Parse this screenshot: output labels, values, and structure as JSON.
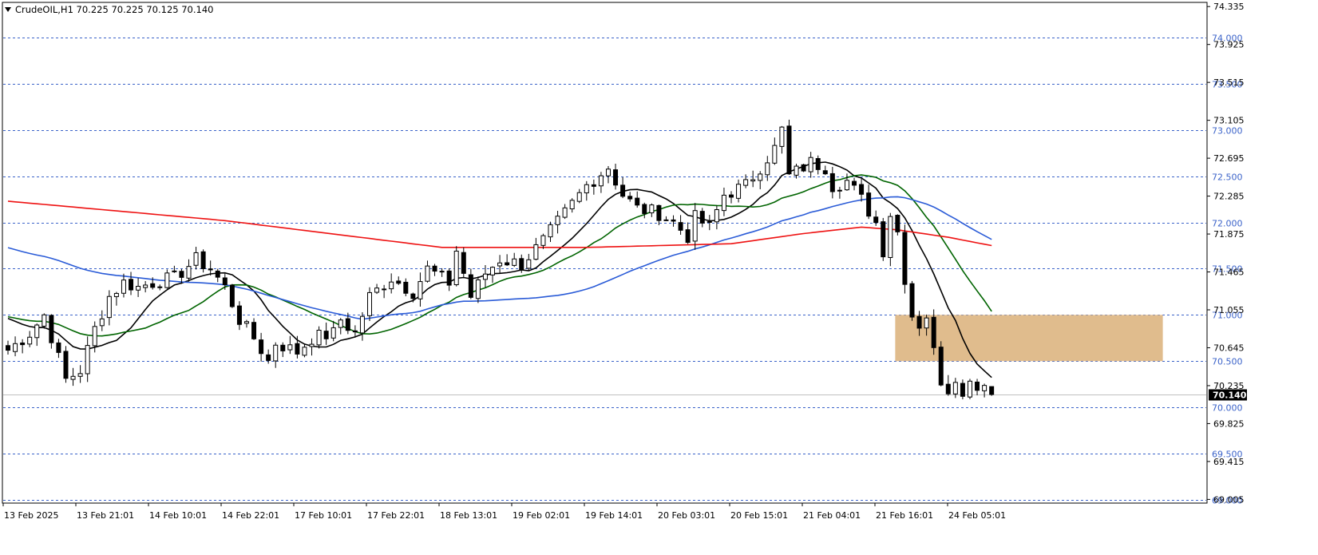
{
  "header": {
    "title": "CrudeOIL,H1  70.225 70.225 70.125 70.140",
    "menu_icon": "triangle-down-icon"
  },
  "chart_data": {
    "type": "candlestick",
    "symbol": "CrudeOIL",
    "timeframe": "H1",
    "ohlc_header": {
      "open": 70.225,
      "high": 70.225,
      "low": 70.125,
      "close": 70.14
    },
    "current_price": 70.14,
    "current_price_label": "70.140",
    "ylim": [
      68.965,
      74.38
    ],
    "price_axis_ticks": [
      74.335,
      73.925,
      73.515,
      73.105,
      72.695,
      72.285,
      71.875,
      71.465,
      71.055,
      70.645,
      70.235,
      69.825,
      69.415,
      69.005
    ],
    "price_axis_tick_labels": [
      "74.335",
      "73.925",
      "73.515",
      "73.105",
      "72.695",
      "72.285",
      "71.875",
      "71.465",
      "71.055",
      "70.645",
      "70.235",
      "69.825",
      "69.415",
      "69.005"
    ],
    "horizontal_levels": [
      {
        "value": 74.0,
        "label": "74.000"
      },
      {
        "value": 73.5,
        "label": "73.500"
      },
      {
        "value": 73.0,
        "label": "73.000"
      },
      {
        "value": 72.5,
        "label": "72.500"
      },
      {
        "value": 72.0,
        "label": "72.000"
      },
      {
        "value": 71.5,
        "label": "71.500"
      },
      {
        "value": 71.0,
        "label": "71.000"
      },
      {
        "value": 70.5,
        "label": "70.500"
      },
      {
        "value": 70.0,
        "label": "70.000"
      },
      {
        "value": 69.5,
        "label": "69.500"
      },
      {
        "value": 69.0,
        "label": "69.000"
      }
    ],
    "time_labels": [
      "13 Feb 2025",
      "13 Feb 21:01",
      "14 Feb 10:01",
      "14 Feb 22:01",
      "17 Feb 10:01",
      "17 Feb 22:01",
      "18 Feb 13:01",
      "19 Feb 02:01",
      "19 Feb 14:01",
      "20 Feb 03:01",
      "20 Feb 15:01",
      "21 Feb 04:01",
      "21 Feb 16:01",
      "24 Feb 05:01"
    ],
    "zone": {
      "low": 70.5,
      "high": 71.0,
      "from_bar": 123,
      "to_bar": 160,
      "color": "#deb887"
    },
    "close_path": [
      [
        0,
        70.62
      ],
      [
        3,
        70.8
      ],
      [
        5,
        71.0
      ],
      [
        8,
        70.3
      ],
      [
        10,
        70.4
      ],
      [
        12,
        70.85
      ],
      [
        14,
        71.2
      ],
      [
        16,
        71.35
      ],
      [
        18,
        71.3
      ],
      [
        20,
        71.35
      ],
      [
        23,
        71.4
      ],
      [
        26,
        71.6
      ],
      [
        28,
        71.5
      ],
      [
        30,
        71.3
      ],
      [
        32,
        70.95
      ],
      [
        34,
        70.75
      ],
      [
        36,
        70.5
      ],
      [
        37,
        70.7
      ],
      [
        40,
        70.6
      ],
      [
        42,
        70.75
      ],
      [
        45,
        70.8
      ],
      [
        46,
        70.95
      ],
      [
        48,
        70.8
      ],
      [
        50,
        71.2
      ],
      [
        53,
        71.4
      ],
      [
        56,
        71.25
      ],
      [
        58,
        71.5
      ],
      [
        61,
        71.35
      ],
      [
        62,
        71.7
      ],
      [
        64,
        71.2
      ],
      [
        66,
        71.45
      ],
      [
        68,
        71.6
      ],
      [
        71,
        71.55
      ],
      [
        74,
        71.8
      ],
      [
        77,
        72.1
      ],
      [
        80,
        72.4
      ],
      [
        83,
        72.6
      ],
      [
        85,
        72.3
      ],
      [
        87,
        72.15
      ],
      [
        90,
        72.1
      ],
      [
        92,
        72.0
      ],
      [
        94,
        71.85
      ],
      [
        95,
        72.05
      ],
      [
        97,
        71.95
      ],
      [
        99,
        72.3
      ],
      [
        102,
        72.4
      ],
      [
        104,
        72.6
      ],
      [
        106,
        72.8
      ],
      [
        107,
        73.0
      ],
      [
        108,
        72.5
      ],
      [
        111,
        72.65
      ],
      [
        113,
        72.6
      ],
      [
        114,
        72.4
      ],
      [
        116,
        72.45
      ],
      [
        118,
        72.25
      ],
      [
        120,
        72.0
      ],
      [
        121,
        71.7
      ],
      [
        122,
        72.1
      ],
      [
        123,
        71.9
      ],
      [
        124,
        71.4
      ],
      [
        125,
        71.0
      ],
      [
        126,
        70.9
      ],
      [
        127,
        71.0
      ],
      [
        128,
        70.6
      ],
      [
        129,
        70.3
      ],
      [
        130,
        70.2
      ],
      [
        131,
        70.35
      ],
      [
        132,
        70.1
      ],
      [
        133,
        70.35
      ],
      [
        134,
        70.2
      ],
      [
        135,
        70.3
      ],
      [
        136,
        70.14
      ]
    ],
    "series": [
      {
        "name": "",
        "color": "#000000",
        "period_bars": 10
      },
      {
        "name": "",
        "color": "#006400",
        "period_bars": 20
      },
      {
        "name": "",
        "color": "#2a5bd7",
        "period_bars": 50
      },
      {
        "name": "",
        "color": "#ee1111",
        "period_bars": 200,
        "path": [
          [
            0,
            72.23
          ],
          [
            30,
            72.02
          ],
          [
            60,
            71.73
          ],
          [
            80,
            71.73
          ],
          [
            100,
            71.77
          ],
          [
            110,
            71.88
          ],
          [
            118,
            71.95
          ],
          [
            123,
            71.92
          ],
          [
            130,
            71.84
          ],
          [
            136,
            71.75
          ]
        ]
      }
    ],
    "ma_warmup_price": 71.0,
    "ma_warmup_start": 71.0,
    "ma200_seed": 72.3,
    "ma50_seed": 71.75,
    "grid": false
  }
}
